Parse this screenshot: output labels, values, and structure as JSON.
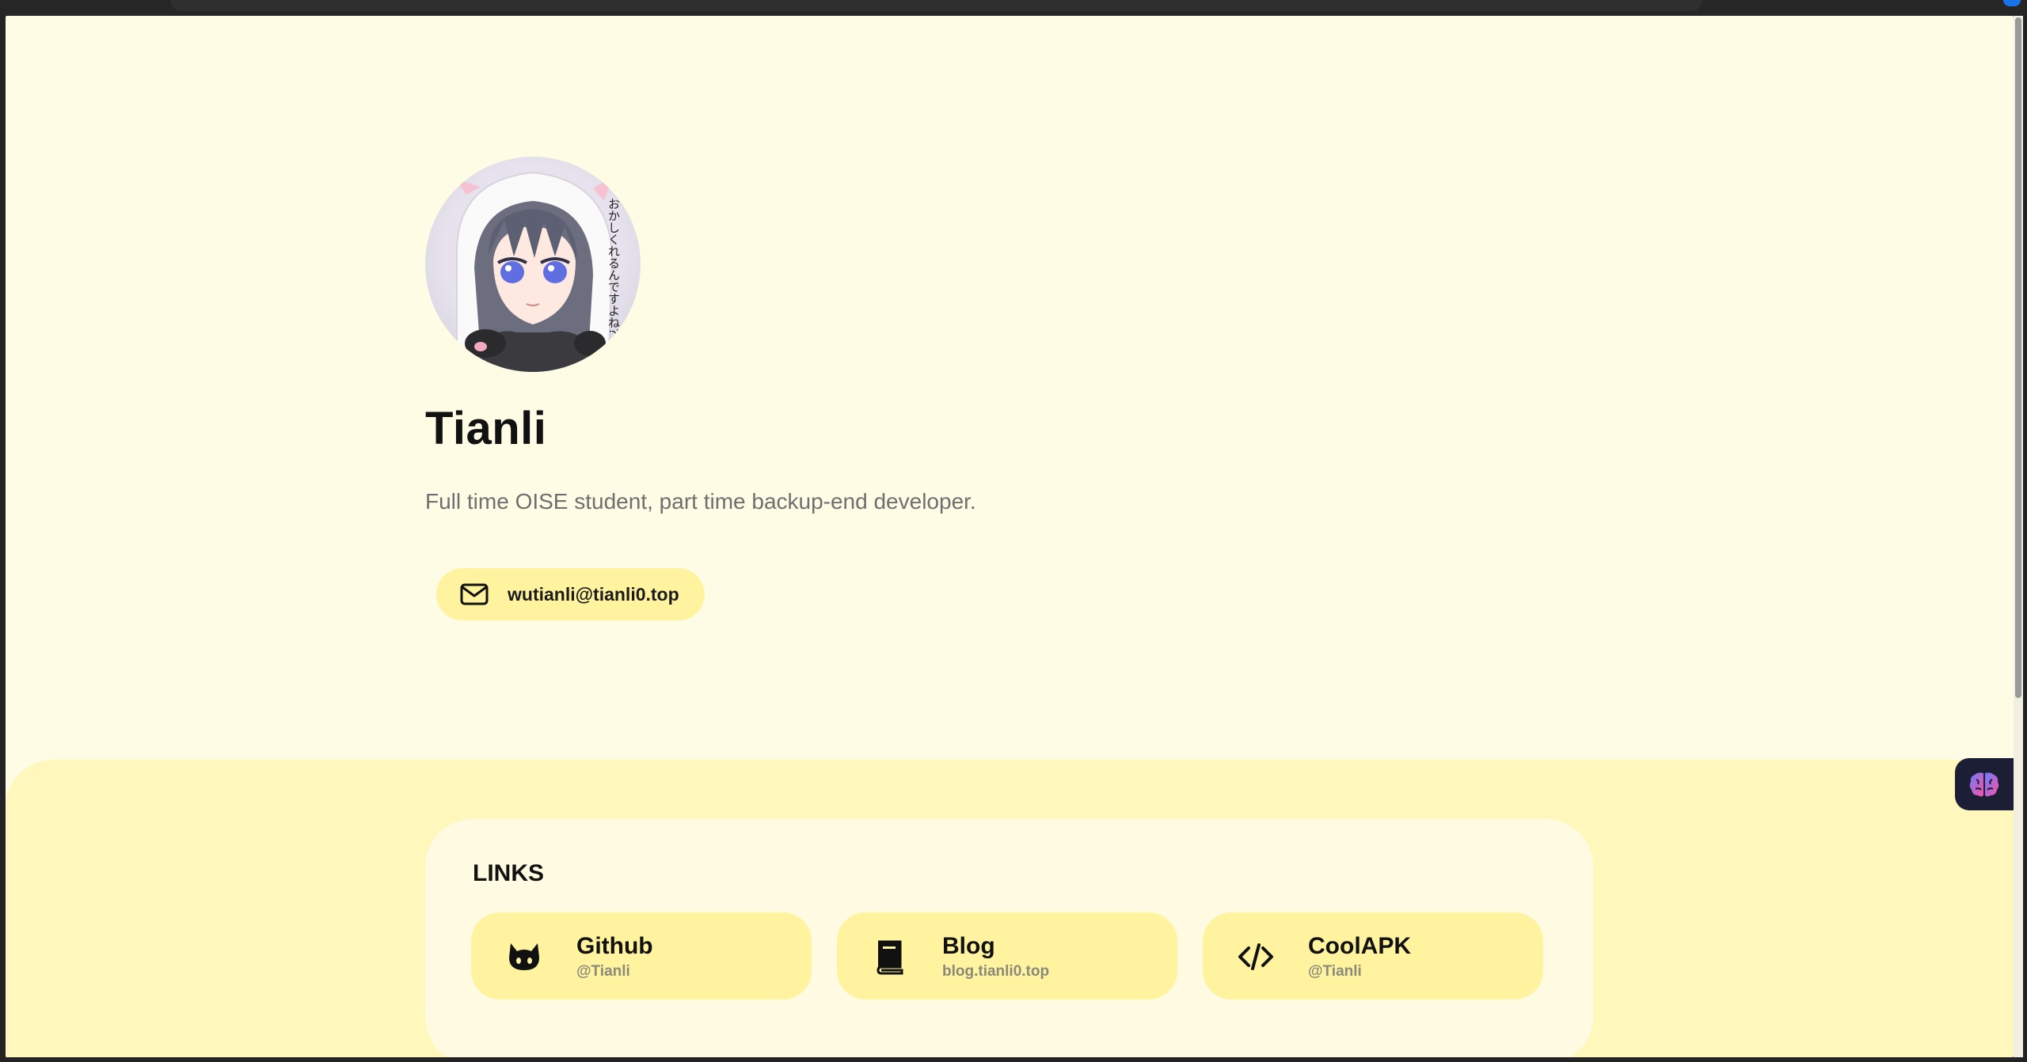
{
  "profile": {
    "name": "Tianli",
    "bio": "Full time OISE student, part time backup-end developer.",
    "email": "wutianli@tianli0.top",
    "avatar_caption": "おかしくれるんですよね?"
  },
  "links": {
    "heading": "LINKS",
    "items": [
      {
        "title": "Github",
        "subtitle": "@Tianli",
        "icon": "github-icon"
      },
      {
        "title": "Blog",
        "subtitle": "blog.tianli0.top",
        "icon": "book-icon"
      },
      {
        "title": "CoolAPK",
        "subtitle": "@Tianli",
        "icon": "code-icon"
      }
    ]
  },
  "colors": {
    "page_bg": "#fffce5",
    "section_bg": "#fff7bc",
    "pill_bg": "#fff3a0",
    "card_bg": "#fffbe3"
  },
  "widgets": {
    "floating_button_icon": "brain-icon"
  }
}
